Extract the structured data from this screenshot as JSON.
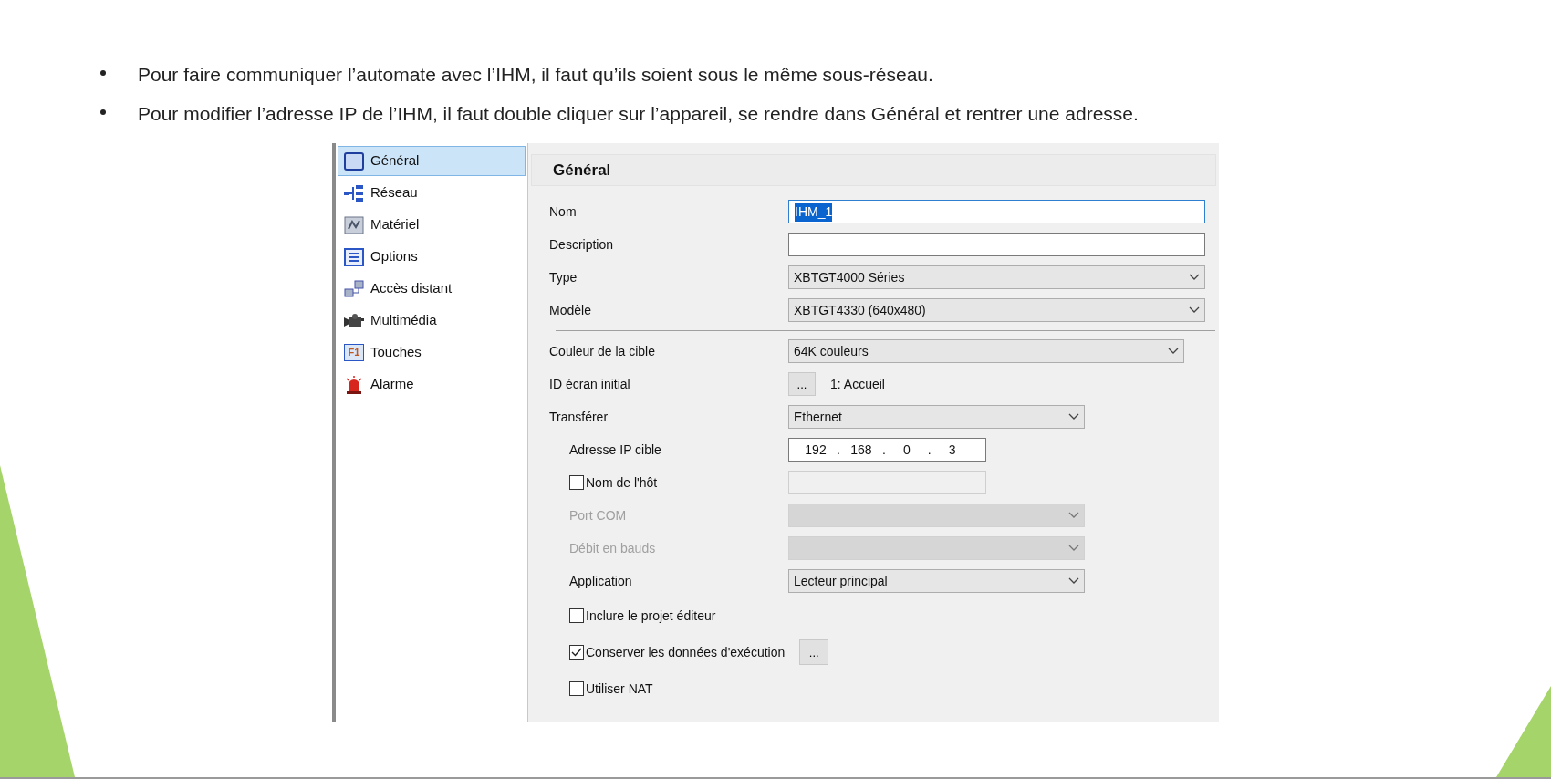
{
  "slide": {
    "bullets": [
      "Pour faire communiquer l’automate avec l’IHM, il faut qu’ils soient sous le même sous-réseau.",
      "Pour modifier l’adresse IP de l’IHM, il faut double cliquer sur l’appareil, se rendre dans Général et rentrer une adresse."
    ]
  },
  "sidebar": {
    "items": [
      {
        "label": "Général",
        "selected": true
      },
      {
        "label": "Réseau",
        "selected": false
      },
      {
        "label": "Matériel",
        "selected": false
      },
      {
        "label": "Options",
        "selected": false
      },
      {
        "label": "Accès distant",
        "selected": false
      },
      {
        "label": "Multimédia",
        "selected": false
      },
      {
        "label": "Touches",
        "key_label": "F1",
        "selected": false
      },
      {
        "label": "Alarme",
        "selected": false
      }
    ]
  },
  "panel": {
    "title": "Général",
    "rows": [
      {
        "kind": "text",
        "label": "Nom",
        "value": "IHM_1",
        "focused": true
      },
      {
        "kind": "text",
        "label": "Description",
        "focused": false
      },
      {
        "kind": "select",
        "label": "Type",
        "value": "XBTGT4000 Séries",
        "disabled": false
      },
      {
        "kind": "select",
        "label": "Modèle",
        "value": "XBTGT4330 (640x480)",
        "disabled": false
      },
      {
        "kind": "separator"
      },
      {
        "kind": "select",
        "label": "Couleur de la cible",
        "value": "64K couleurs",
        "disabled": false
      },
      {
        "kind": "button_value",
        "label": "ID écran initial",
        "button": "...",
        "value": "1: Accueil"
      },
      {
        "kind": "select",
        "label": "Transférer",
        "value": "Ethernet",
        "disabled": false,
        "children": [
          {
            "kind": "ip",
            "label": "Adresse IP cible",
            "octets": [
              "192",
              "168",
              "0",
              "3"
            ],
            "separators": [
              ".",
              ".",
              "."
            ]
          },
          {
            "kind": "checkbox_field",
            "label": "Nom de l'hôt",
            "checked": false
          },
          {
            "kind": "select",
            "label": "Port COM",
            "disabled": true
          },
          {
            "kind": "select",
            "label": "Débit en bauds",
            "disabled": true
          },
          {
            "kind": "select",
            "label": "Application",
            "value": "Lecteur principal",
            "disabled": false
          },
          {
            "kind": "checkbox",
            "label": "Inclure le projet éditeur",
            "checked": false
          },
          {
            "kind": "checkbox",
            "label": "Conserver les données d'exécution",
            "checked": true,
            "button": "..."
          },
          {
            "kind": "checkbox",
            "label": "Utiliser NAT",
            "checked": false
          }
        ]
      }
    ]
  }
}
